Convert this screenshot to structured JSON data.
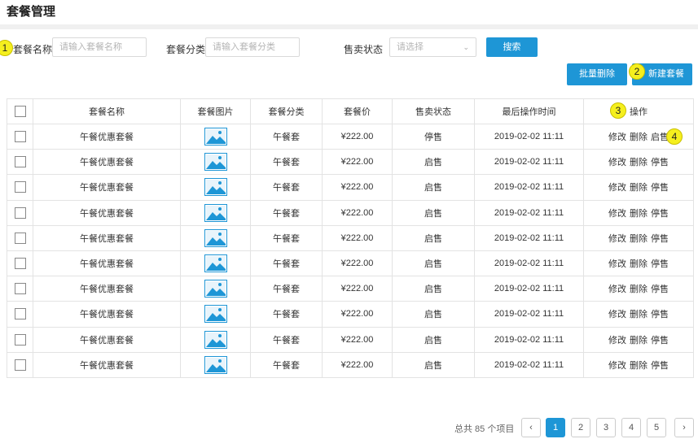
{
  "title": "套餐管理",
  "filters": {
    "name_label": "套餐名称",
    "name_placeholder": "请输入套餐名称",
    "category_label": "套餐分类",
    "category_placeholder": "请输入套餐分类",
    "status_label": "售卖状态",
    "status_placeholder": "请选择",
    "search_button": "搜索"
  },
  "actions": {
    "batch_delete": "批量删除",
    "new_package": "新建套餐"
  },
  "badges": [
    "1",
    "2",
    "3",
    "4"
  ],
  "table": {
    "headers": [
      "套餐名称",
      "套餐图片",
      "套餐分类",
      "套餐价",
      "售卖状态",
      "最后操作时间",
      "操作"
    ],
    "rows": [
      {
        "name": "午餐优惠套餐",
        "category": "午餐套",
        "price": "¥222.00",
        "status": "停售",
        "time": "2019-02-02 11:11",
        "edit": "修改",
        "delete": "删除",
        "toggle": "启售"
      },
      {
        "name": "午餐优惠套餐",
        "category": "午餐套",
        "price": "¥222.00",
        "status": "启售",
        "time": "2019-02-02 11:11",
        "edit": "修改",
        "delete": "删除",
        "toggle": "停售"
      },
      {
        "name": "午餐优惠套餐",
        "category": "午餐套",
        "price": "¥222.00",
        "status": "启售",
        "time": "2019-02-02 11:11",
        "edit": "修改",
        "delete": "删除",
        "toggle": "停售"
      },
      {
        "name": "午餐优惠套餐",
        "category": "午餐套",
        "price": "¥222.00",
        "status": "启售",
        "time": "2019-02-02 11:11",
        "edit": "修改",
        "delete": "删除",
        "toggle": "停售"
      },
      {
        "name": "午餐优惠套餐",
        "category": "午餐套",
        "price": "¥222.00",
        "status": "启售",
        "time": "2019-02-02 11:11",
        "edit": "修改",
        "delete": "删除",
        "toggle": "停售"
      },
      {
        "name": "午餐优惠套餐",
        "category": "午餐套",
        "price": "¥222.00",
        "status": "启售",
        "time": "2019-02-02 11:11",
        "edit": "修改",
        "delete": "删除",
        "toggle": "停售"
      },
      {
        "name": "午餐优惠套餐",
        "category": "午餐套",
        "price": "¥222.00",
        "status": "启售",
        "time": "2019-02-02 11:11",
        "edit": "修改",
        "delete": "删除",
        "toggle": "停售"
      },
      {
        "name": "午餐优惠套餐",
        "category": "午餐套",
        "price": "¥222.00",
        "status": "启售",
        "time": "2019-02-02 11:11",
        "edit": "修改",
        "delete": "删除",
        "toggle": "停售"
      },
      {
        "name": "午餐优惠套餐",
        "category": "午餐套",
        "price": "¥222.00",
        "status": "启售",
        "time": "2019-02-02 11:11",
        "edit": "修改",
        "delete": "删除",
        "toggle": "停售"
      },
      {
        "name": "午餐优惠套餐",
        "category": "午餐套",
        "price": "¥222.00",
        "status": "启售",
        "time": "2019-02-02 11:11",
        "edit": "修改",
        "delete": "删除",
        "toggle": "停售"
      }
    ]
  },
  "pagination": {
    "total_text": "总共 85 个项目",
    "pages": [
      "1",
      "2",
      "3",
      "4",
      "5"
    ],
    "current": "1",
    "prev_icon": "chevron-left-icon",
    "next_icon": "chevron-right-icon"
  },
  "colors": {
    "primary": "#1e96d6",
    "badge": "#f5ef1e"
  }
}
